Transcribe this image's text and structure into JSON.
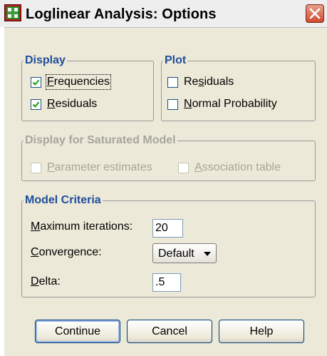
{
  "window": {
    "title": "Loglinear Analysis: Options"
  },
  "display_group": {
    "legend": "Display",
    "frequencies": {
      "label_first": "F",
      "label_rest": "requencies",
      "checked": true
    },
    "residuals": {
      "label_first": "R",
      "label_rest": "esiduals",
      "checked": true
    }
  },
  "plot_group": {
    "legend": "Plot",
    "residuals": {
      "label_pre": "Re",
      "label_u": "s",
      "label_post": "iduals",
      "checked": false
    },
    "normal_probability": {
      "label_first": "N",
      "label_rest": "ormal Probability",
      "checked": false
    }
  },
  "saturated_group": {
    "legend": "Display for Saturated Model",
    "parameter_estimates": {
      "label_first": "P",
      "label_rest": "arameter estimates",
      "checked": false,
      "enabled": false
    },
    "association_table": {
      "label_first": "A",
      "label_rest": "ssociation table",
      "checked": false,
      "enabled": false
    }
  },
  "model_criteria": {
    "legend": "Model Criteria",
    "max_iterations": {
      "label_first": "M",
      "label_rest": "aximum iterations:",
      "value": "20"
    },
    "convergence": {
      "label_first": "C",
      "label_rest": "onvergence:",
      "value": "Default"
    },
    "delta": {
      "label_first": "D",
      "label_rest": "elta:",
      "value": ".5"
    }
  },
  "buttons": {
    "continue": "Continue",
    "cancel": "Cancel",
    "help": "Help"
  },
  "colors": {
    "legend_blue": "#1f4d9b",
    "disabled_text": "#a7a69b",
    "dialog_bg": "#ece9d8"
  }
}
